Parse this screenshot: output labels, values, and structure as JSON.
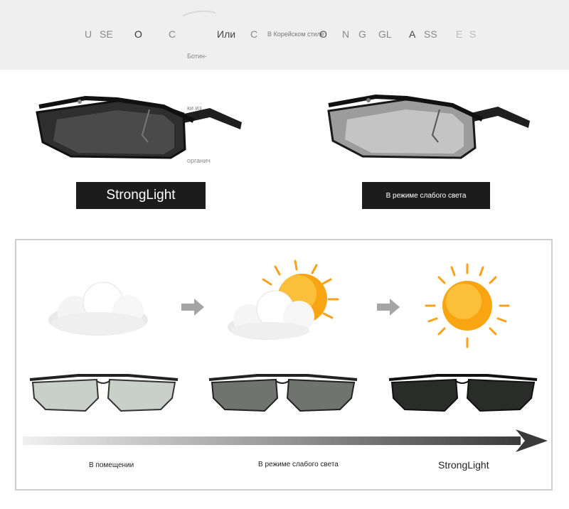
{
  "header": {
    "words": [
      "U",
      "SE",
      "O",
      "C",
      "Или",
      "C",
      "В Корейском стиле",
      "O",
      "N",
      "G",
      "GL",
      "A",
      "SS",
      "E",
      "S"
    ]
  },
  "fragments": {
    "f1": "Ботин-",
    "f2": "ки из",
    "f3": "органич"
  },
  "labels": {
    "strong_light": "StrongLight",
    "low_light": "В режиме слабого света"
  },
  "stages": {
    "indoor": "В помещении",
    "low_light": "В режиме слабого света",
    "strong_light": "StrongLight"
  },
  "colors": {
    "sun_core": "#f9a411",
    "sun_ray": "#f7a21a",
    "arrow_gray": "#9a9a9a",
    "dark_label": "#1c1c1c"
  }
}
